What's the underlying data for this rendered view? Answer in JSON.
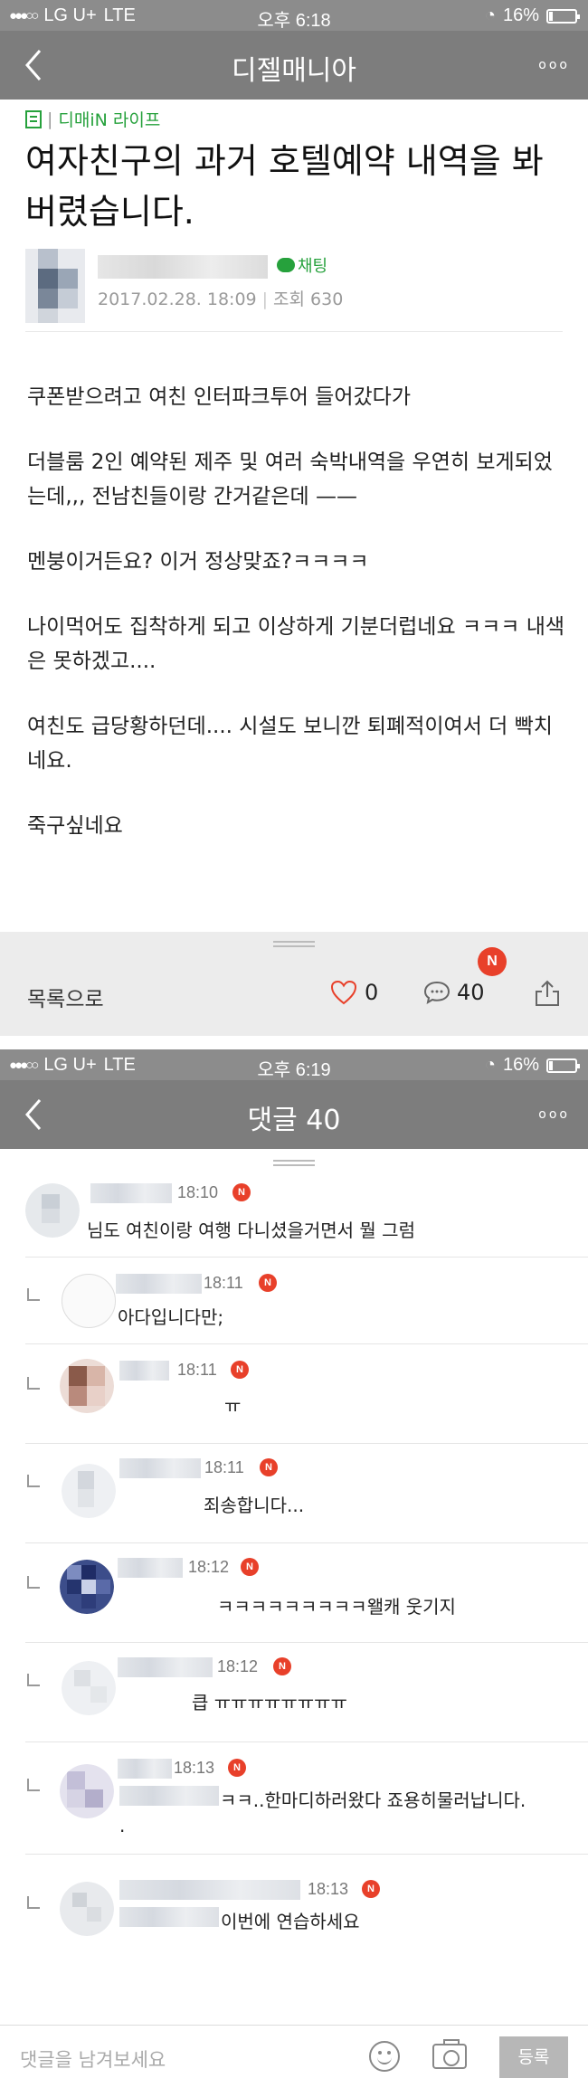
{
  "screen1": {
    "status": {
      "carrier": "LG U+",
      "network": "LTE",
      "time": "오후 6:18",
      "battery": "16%",
      "battery_level": 0.16
    },
    "nav": {
      "title": "디젤매니아",
      "more": "ooo"
    },
    "article": {
      "category": "디매iN 라이프",
      "title": "여자친구의 과거 호텔예약 내역을 봐버렸습니다.",
      "chat_tag": "채팅",
      "date": "2017.02.28. 18:09",
      "views": "조회 630",
      "paragraphs": [
        "쿠폰받으려고 여친 인터파크투어 들어갔다가",
        "더블룸 2인 예약된 제주 및 여러 숙박내역을 우연히 보게되었는데,,, 전남친들이랑 간거같은데 ——",
        "멘붕이거든요? 이거 정상맞죠?ㅋㅋㅋㅋ",
        "나이먹어도 집착하게 되고 이상하게 기분더럽네요 ㅋㅋㅋ 내색은 못하겠고....",
        "여친도 급당황하던데.... 시설도 보니깐 퇴폐적이여서 더 빡치네요.",
        "죽구싶네요"
      ]
    },
    "actions": {
      "to_list": "목록으로",
      "likes": "0",
      "comments": "40",
      "new_badge": "N"
    }
  },
  "screen2": {
    "status": {
      "carrier": "LG U+",
      "network": "LTE",
      "time": "오후 6:19",
      "battery": "16%",
      "battery_level": 0.16
    },
    "nav": {
      "title": "댓글 40",
      "more": "ooo"
    },
    "comments": [
      {
        "time": "18:10",
        "badge": "N",
        "text": "님도 여친이랑 여행 다니셨을거면서 뭘 그럼",
        "reply": false
      },
      {
        "time": "18:11",
        "badge": "N",
        "text": "아다입니다만;",
        "reply": true
      },
      {
        "time": "18:11",
        "badge": "N",
        "text": "ㅠ",
        "reply": true
      },
      {
        "time": "18:11",
        "badge": "N",
        "text": "죄송합니다...",
        "reply": true
      },
      {
        "time": "18:12",
        "badge": "N",
        "text": "ㅋㅋㅋㅋㅋㅋㅋㅋㅋ왤캐 웃기지",
        "reply": true
      },
      {
        "time": "18:12",
        "badge": "N",
        "text": "큽 ㅠㅠㅠㅠㅠㅠㅠㅠ",
        "reply": true
      },
      {
        "time": "18:13",
        "badge": "N",
        "text": "ㅋㅋ..한마디하러왔다 죠용히물러납니다.",
        "reply": true
      },
      {
        "time": "18:13",
        "badge": "N",
        "text": "이번에 연습하세요",
        "reply": true
      }
    ],
    "input": {
      "placeholder": "댓글을 남겨보세요",
      "submit": "등록"
    }
  }
}
